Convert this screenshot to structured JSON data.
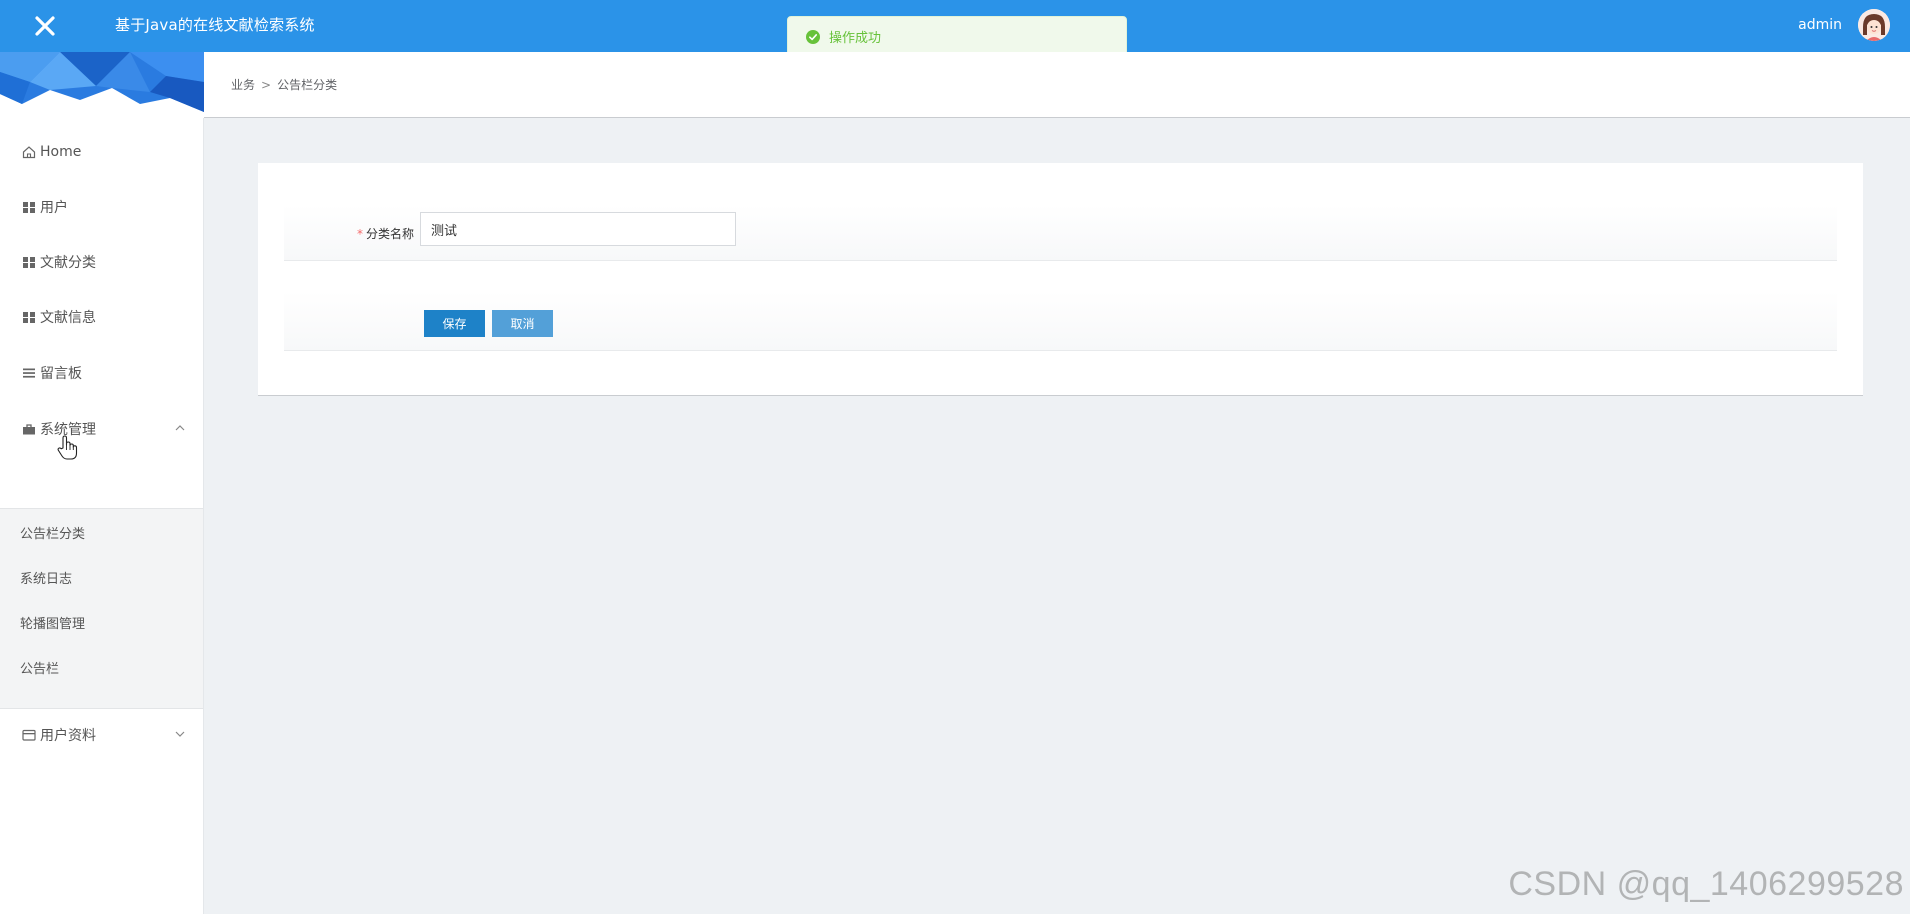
{
  "header": {
    "app_title": "基于Java的在线文献检索系统",
    "username": "admin"
  },
  "toast": {
    "message": "操作成功"
  },
  "sidebar": {
    "items": [
      {
        "label": "Home",
        "icon": "home-icon"
      },
      {
        "label": "用户",
        "icon": "grid-icon"
      },
      {
        "label": "文献分类",
        "icon": "grid-icon"
      },
      {
        "label": "文献信息",
        "icon": "grid-icon"
      },
      {
        "label": "留言板",
        "icon": "list-icon"
      },
      {
        "label": "系统管理",
        "icon": "briefcase-icon",
        "expanded": true
      },
      {
        "label": "用户资料",
        "icon": "card-icon",
        "expanded": false
      }
    ],
    "submenu": [
      {
        "label": "公告栏分类"
      },
      {
        "label": "系统日志"
      },
      {
        "label": "轮播图管理"
      },
      {
        "label": "公告栏"
      }
    ]
  },
  "breadcrumb": {
    "root": "业务",
    "separator": ">",
    "current": "公告栏分类"
  },
  "form": {
    "required_mark": "*",
    "name_label": "分类名称",
    "name_value": "测试",
    "save_label": "保存",
    "cancel_label": "取消"
  },
  "watermark": "CSDN @qq_1406299528",
  "colors": {
    "topbar": "#2b93e8",
    "save_button": "#1e82c8",
    "cancel_button": "#53a0d8",
    "success": "#67c23a"
  }
}
